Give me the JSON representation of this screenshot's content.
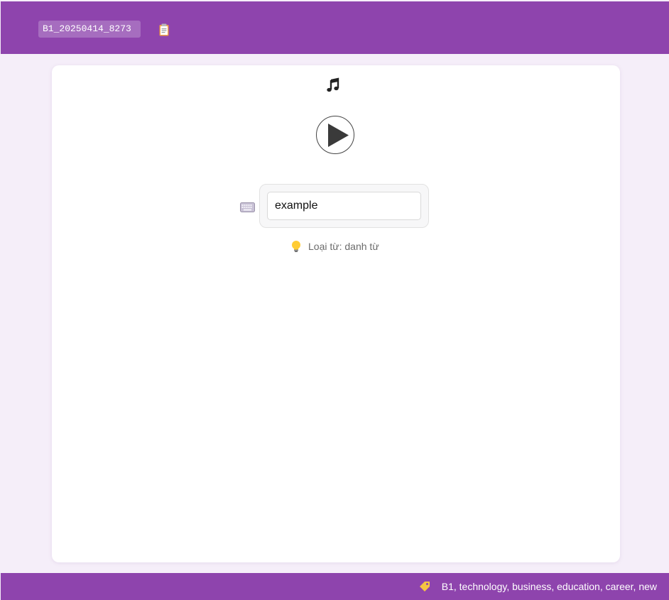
{
  "header": {
    "session_id": "B1_20250414_8273",
    "copy_icon": "clipboard-icon"
  },
  "card": {
    "audio_icon": "music-note-icon",
    "play_icon": "play-icon",
    "input_icon": "keyboard-icon",
    "answer": {
      "value": "example",
      "placeholder": ""
    },
    "hint": {
      "icon": "lightbulb-icon",
      "text": "Loại từ: danh từ"
    }
  },
  "footer": {
    "tags_icon": "tag-icon",
    "tags_text": "B1, technology, business, education, career, new"
  },
  "colors": {
    "brand": "#8e44ad",
    "background": "#f5eef9",
    "card": "#ffffff"
  }
}
